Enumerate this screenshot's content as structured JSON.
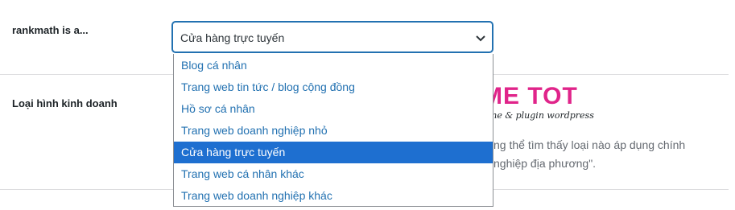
{
  "fields": {
    "rankmath_label": "rankmath is a...",
    "business_type_label": "Loại hình kinh doanh"
  },
  "select": {
    "value": "Cửa hàng trực tuyến",
    "options": [
      "Blog cá nhân",
      "Trang web tin tức / blog cộng đồng",
      "Hồ sơ cá nhân",
      "Trang web doanh nghiệp nhỏ",
      "Cửa hàng trực tuyến",
      "Trang web cá nhân khác",
      "Trang web doanh nghiệp khác"
    ],
    "selected_index": 4,
    "chevron_icon": "chevron-down-icon"
  },
  "description": {
    "line1": "ng thể tìm thấy loại nào áp dụng chính",
    "line2": "nghiệp địa phương\"."
  },
  "watermark": {
    "brand": "THEME TOT",
    "tagline": "Thế giới theme & plugin wordpress"
  },
  "colors": {
    "accent": "#2271b1",
    "selected_bg": "#1e6fd0",
    "brand_pink": "#e0248a"
  }
}
